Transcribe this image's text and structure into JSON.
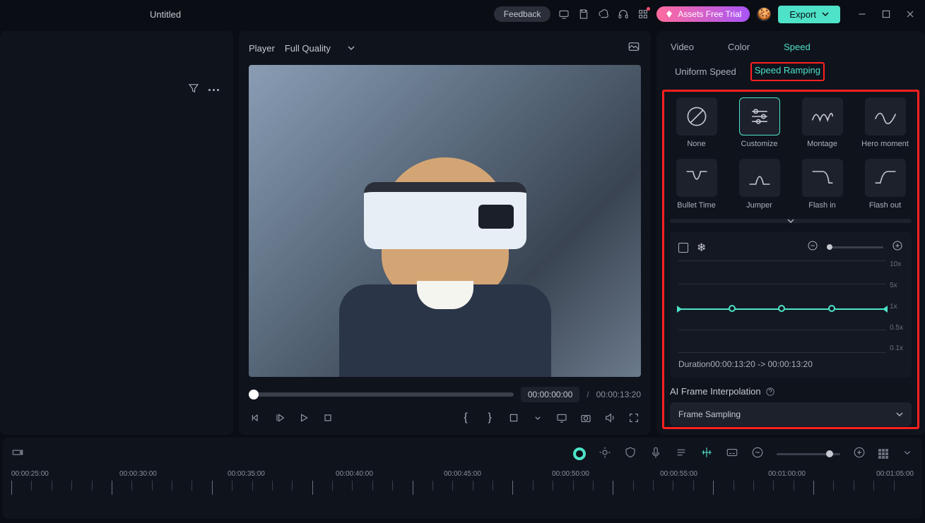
{
  "header": {
    "title": "Untitled",
    "feedback": "Feedback",
    "assets_trial": "Assets Free Trial",
    "export": "Export"
  },
  "player": {
    "label": "Player",
    "quality": "Full Quality",
    "current_time": "00:00:00:00",
    "total_time": "00:00:13:20"
  },
  "inspector": {
    "tabs": {
      "video": "Video",
      "color": "Color",
      "speed": "Speed"
    },
    "subtabs": {
      "uniform": "Uniform Speed",
      "ramping": "Speed Ramping"
    },
    "presets": {
      "none": "None",
      "customize": "Customize",
      "montage": "Montage",
      "hero": "Hero moment",
      "bullet": "Bullet Time",
      "jumper": "Jumper",
      "flashin": "Flash in",
      "flashout": "Flash out"
    },
    "ramp_y": {
      "y10": "10x",
      "y5": "5x",
      "y1": "1x",
      "y05": "0.5x",
      "y01": "0.1x"
    },
    "duration_label": "Duration",
    "duration_from": "00:00:13:20",
    "duration_arrow": "->",
    "duration_to": "00:00:13:20",
    "ai_title": "AI Frame Interpolation",
    "ai_value": "Frame Sampling"
  },
  "timeline": {
    "labels": [
      "00:00:25:00",
      "00:00:30:00",
      "00:00:35:00",
      "00:00:40:00",
      "00:00:45:00",
      "00:00:50:00",
      "00:00:55:00",
      "00:01:00:00",
      "00:01:05:00"
    ]
  }
}
